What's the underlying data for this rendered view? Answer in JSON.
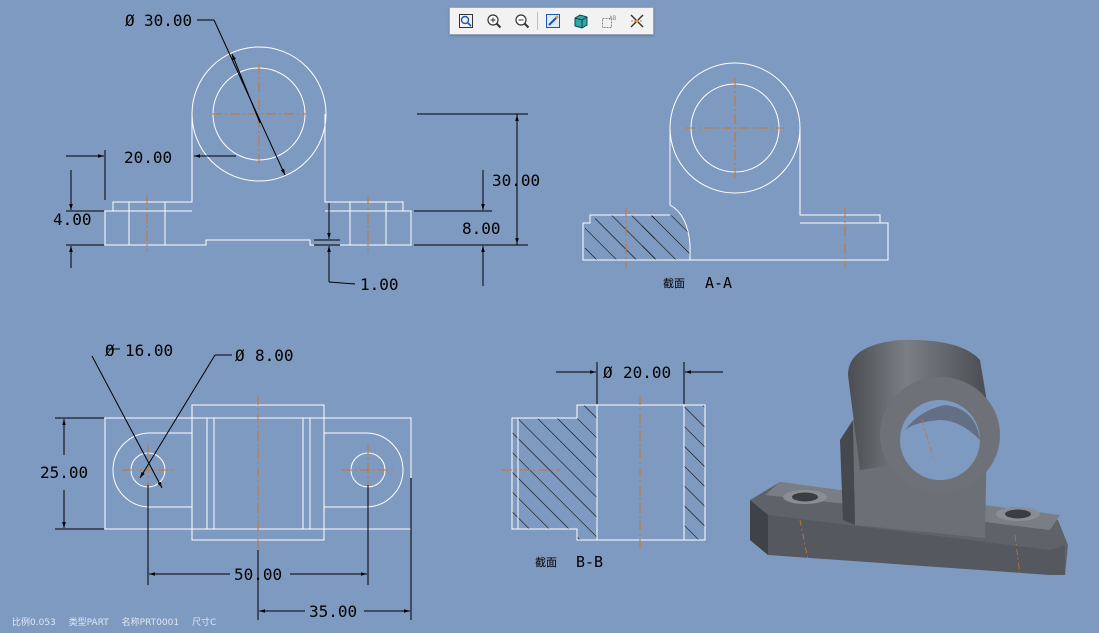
{
  "toolbar": {
    "buttons": [
      {
        "name": "refit-icon"
      },
      {
        "name": "zoom-in-icon"
      },
      {
        "name": "zoom-out-icon"
      },
      {
        "name": "repaint-icon"
      },
      {
        "name": "display-style-icon"
      },
      {
        "name": "annotation-display-icon"
      },
      {
        "name": "datum-display-icon"
      }
    ]
  },
  "dims": {
    "d30dia": "30.00",
    "d20": "20.00",
    "d4": "4.00",
    "d1": "1.00",
    "d30": "30.00",
    "d8": "8.00",
    "d16dia": "16.00",
    "d8dia": "8.00",
    "d25": "25.00",
    "d50": "50.00",
    "d35": "35.00",
    "d20dia": "20.00"
  },
  "sections": {
    "aa_label": "截面",
    "aa_name": "A-A",
    "bb_label": "截面",
    "bb_name": "B-B"
  },
  "status": {
    "scale": "比例0.053",
    "type": "类型PART",
    "name": "名称PRT0001",
    "size": "尺寸C"
  },
  "colors": {
    "background": "#7f9ac0",
    "line": "#ffffff",
    "dim": "#000000",
    "center": "#c8742a"
  }
}
